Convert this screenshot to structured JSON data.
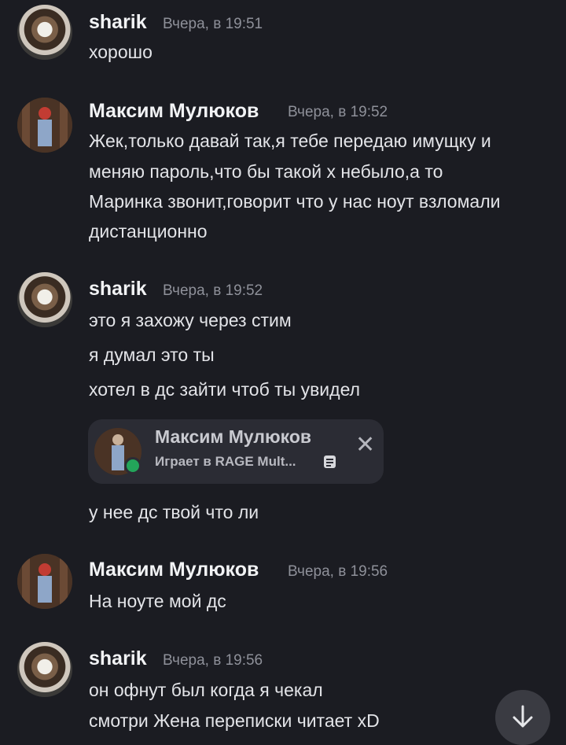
{
  "messages": [
    {
      "author": "sharik",
      "time": "Вчера, в 19:51",
      "lines": [
        "хорошо"
      ]
    },
    {
      "author": "Максим Мулюков",
      "time": "Вчера, в 19:52",
      "lines": [
        "Жек,только давай так,я тебе передаю имущку и",
        "меняю пароль,что бы такой х небыло,а то",
        "Маринка звонит,говорит что у нас ноут взломали",
        "дистанционно"
      ]
    },
    {
      "author": "sharik",
      "time": "Вчера, в 19:52",
      "lines": [
        "это я захожу через стим",
        "я думал это ты",
        "хотел в дс зайти чтоб ты увидел",
        "у нее дс твой что ли"
      ]
    },
    {
      "author": "Максим Мулюков",
      "time": "Вчера, в 19:56",
      "lines": [
        "На ноуте мой дс"
      ]
    },
    {
      "author": "sharik",
      "time": "Вчера, в 19:56",
      "lines": [
        "он офнут был когда я чекал",
        "смотри Жена переписки читает xD"
      ]
    }
  ],
  "embed": {
    "name": "Максим Мулюков",
    "status": "Играет в RAGE Mult..."
  },
  "icons": {
    "close": "close-icon",
    "scroll": "arrow-down-icon",
    "doc": "document-icon"
  },
  "colors": {
    "background": "#1b1c22",
    "online": "#23a55a"
  }
}
